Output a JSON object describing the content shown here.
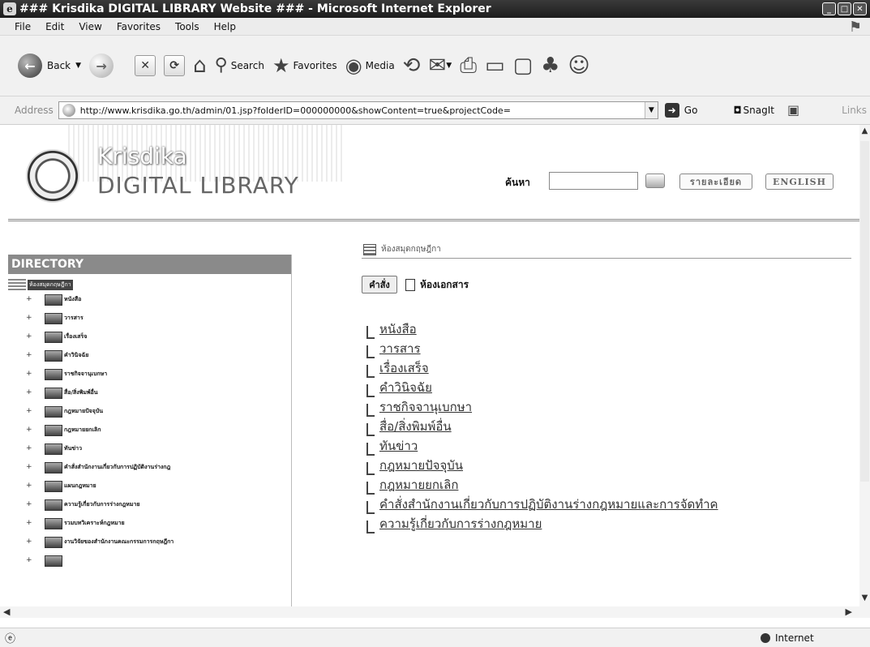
{
  "window": {
    "title": "### Krisdika DIGITAL LIBRARY Website ### - Microsoft Internet Explorer",
    "ie_icon": "ie-icon",
    "controls": [
      "minimize",
      "maximize",
      "close"
    ]
  },
  "menubar": {
    "items": [
      "File",
      "Edit",
      "View",
      "Favorites",
      "Tools",
      "Help"
    ]
  },
  "toolbar": {
    "back": "Back",
    "search": "Search",
    "favorites": "Favorites",
    "media": "Media"
  },
  "addressbar": {
    "label": "Address",
    "url": "http://www.krisdika.go.th/admin/01.jsp?folderID=000000000&showContent=true&projectCode=",
    "go": "Go",
    "snagit": "SnagIt",
    "links": "Links"
  },
  "header": {
    "brand_top": "Krisdika",
    "brand_bottom": "DIGITAL LIBRARY",
    "search_label": "ค้นหา",
    "search_value": "",
    "detail_button": "รายละเอียด",
    "english_button": "ENGLISH"
  },
  "directory": {
    "heading": "DIRECTORY",
    "root": "ห้องสมุดกฤษฎีกา",
    "items": [
      "หนังสือ",
      "วารสาร",
      "เรื่องเสร็จ",
      "คำวินิจฉัย",
      "ราชกิจจานุเบกษา",
      "สื่อ/สิ่งพิมพ์อื่น",
      "กฎหมายปัจจุบัน",
      "กฎหมายยกเลิก",
      "ทันข่าว",
      "คำสั่งสำนักงานเกี่ยวกับการปฏิบัติงานร่างกฎ",
      "แผนกฎหมาย",
      "ความรู้เกี่ยวกับการร่างกฎหมาย",
      "รวมบทวิเคราะห์กฎหมาย",
      "งานวิจัยของสำนักงานคณะกรรมการกฤษฎีกา",
      ""
    ]
  },
  "content": {
    "breadcrumb": "ห้องสมุดกฤษฎีกา",
    "command_button": "คำสั่ง",
    "page_title": "ห้องเอกสาร",
    "items": [
      "หนังสือ",
      "วารสาร",
      "เรื่องเสร็จ",
      "คำวินิจฉัย",
      "ราชกิจจานุเบกษา",
      "สื่อ/สิ่งพิมพ์อื่น",
      "ทันข่าว",
      "กฎหมายปัจจุบัน",
      "กฎหมายยกเลิก",
      "คำสั่งสำนักงานเกี่ยวกับการปฏิบัติงานร่างกฎหมายและการจัดทำค",
      "ความรู้เกี่ยวกับการร่างกฎหมาย"
    ]
  },
  "statusbar": {
    "zone": "Internet"
  }
}
